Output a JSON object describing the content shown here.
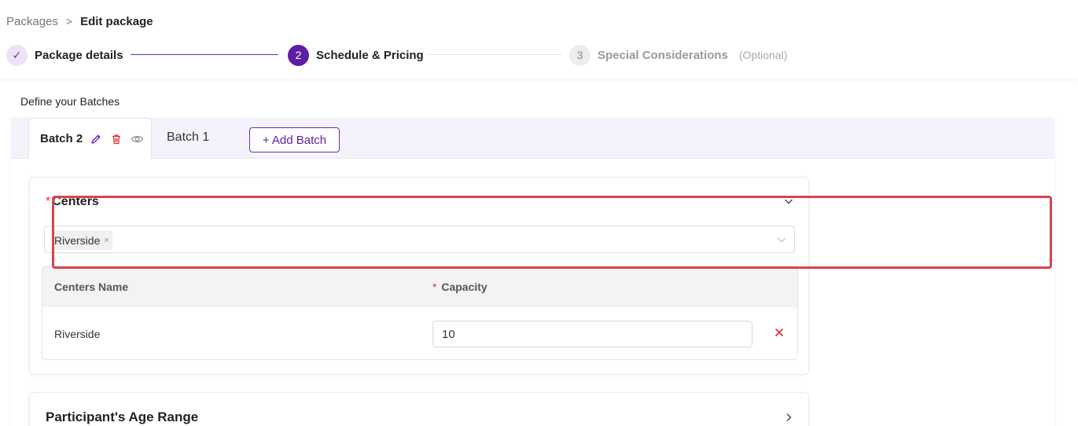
{
  "breadcrumb": {
    "root": "Packages",
    "separator": ">",
    "current": "Edit package"
  },
  "stepper": {
    "steps": [
      {
        "marker": "✓",
        "label": "Package details",
        "state": "done"
      },
      {
        "marker": "2",
        "label": "Schedule & Pricing",
        "state": "active"
      },
      {
        "marker": "3",
        "label": "Special Considerations",
        "note": "(Optional)",
        "state": "pending"
      }
    ]
  },
  "section_title": "Define your Batches",
  "tabs": {
    "active": {
      "label": "Batch 2",
      "icons": [
        "edit-icon",
        "trash-icon",
        "eye-icon"
      ]
    },
    "inactive": {
      "label": "Batch 1"
    },
    "add_label": "+ Add Batch"
  },
  "centers": {
    "required_mark": "*",
    "title": "Centers",
    "selected_tag": "Riverside",
    "tag_remove": "×",
    "table": {
      "headers": {
        "name": "Centers Name",
        "capacity_required": "*",
        "capacity": "Capacity"
      },
      "rows": [
        {
          "name": "Riverside",
          "capacity": "10"
        }
      ]
    }
  },
  "age_range": {
    "title": "Participant's Age Range"
  },
  "colors": {
    "accent": "#5e1ea3",
    "danger": "#d33",
    "highlight": "#d9434b"
  }
}
